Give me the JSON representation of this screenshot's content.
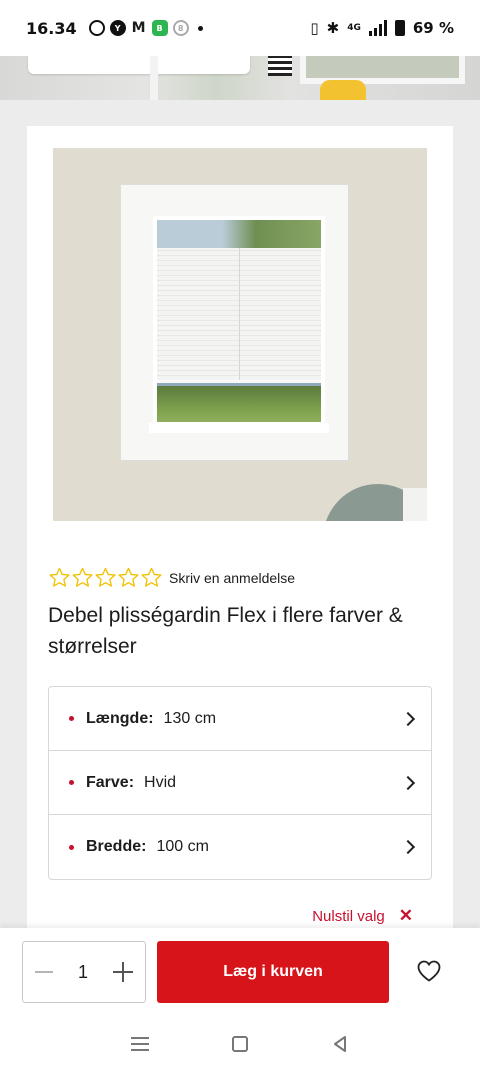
{
  "status_bar": {
    "time": "16.34",
    "battery_text": "69 %",
    "network": "4G",
    "icons": [
      "whatsapp-icon",
      "yale-icon",
      "gmail-icon",
      "app-icon",
      "notification-icon",
      "dot-icon",
      "vibrate-icon",
      "bluetooth-icon",
      "signal-icon",
      "battery-icon"
    ]
  },
  "product": {
    "review_link": "Skriv en anmeldelse",
    "rating_stars": 0,
    "rating_max": 5,
    "title": "Debel plisségardin Flex i flere farver & størrelser"
  },
  "options": [
    {
      "label": "Længde:",
      "value": "130 cm"
    },
    {
      "label": "Farve:",
      "value": "Hvid"
    },
    {
      "label": "Bredde:",
      "value": "100 cm"
    }
  ],
  "reset_label": "Nulstil valg",
  "reset_icon": "✕",
  "action_bar": {
    "quantity": "1",
    "add_to_cart_label": "Læg i kurven"
  },
  "colors": {
    "brand_red": "#d7141a",
    "star_yellow": "#f2c100"
  }
}
